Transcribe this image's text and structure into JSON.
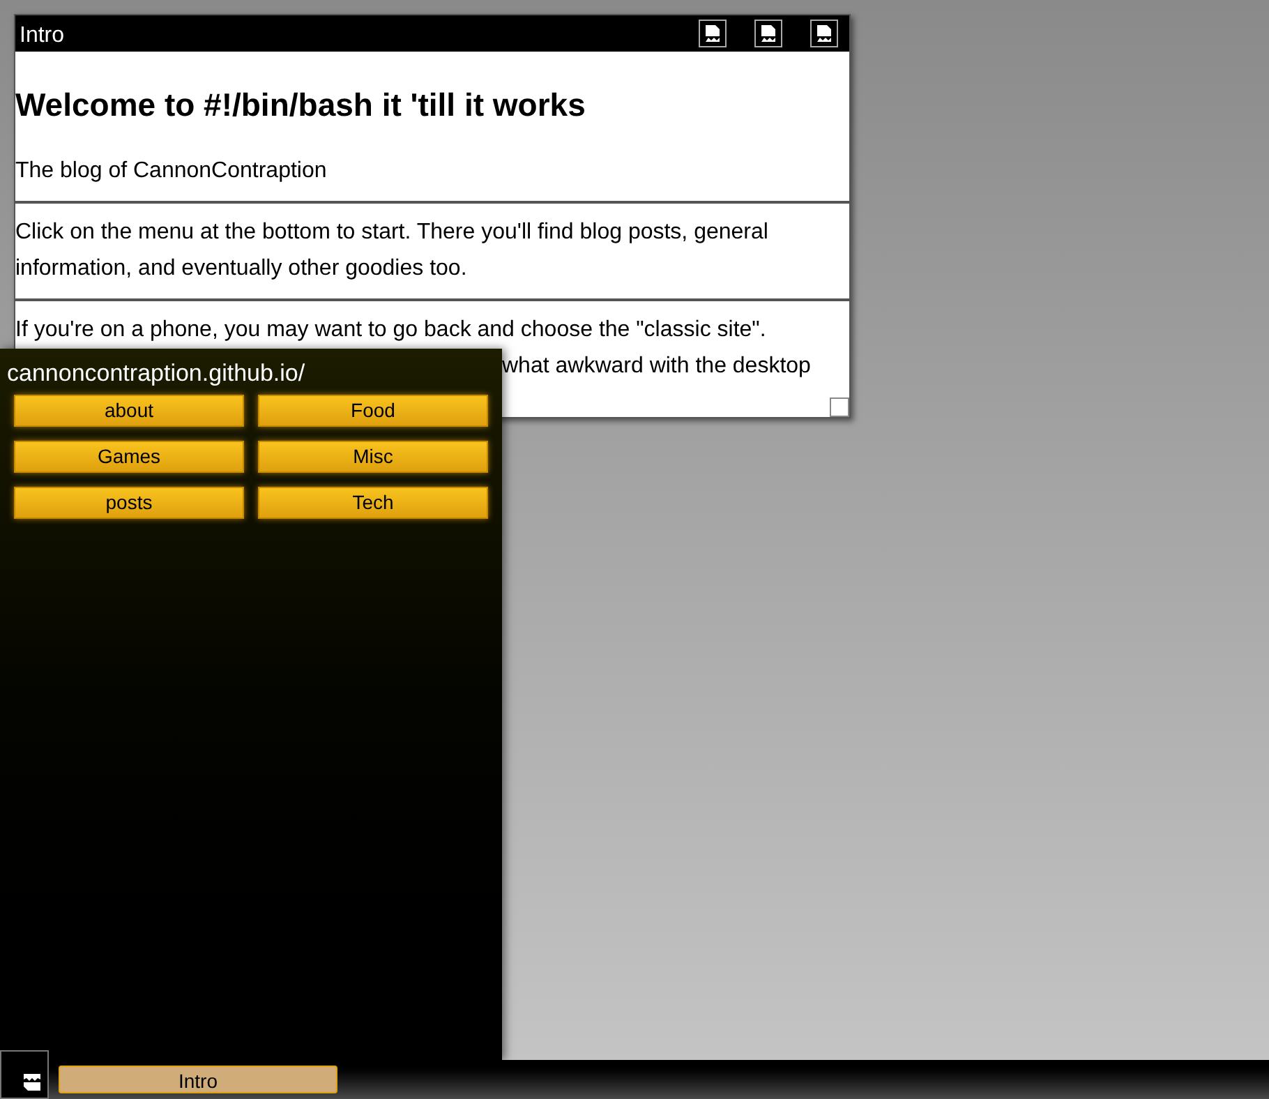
{
  "window": {
    "title": "Intro",
    "heading": "Welcome to #!/bin/bash it 'till it works",
    "paragraphs": [
      "The blog of CannonContraption",
      "Click on the menu at the bottom to start. There you'll find blog posts, general information, and eventually other goodies too.",
      "If you're on a phone, you may want to go back and choose the \"classic site\"."
    ],
    "partly_hidden_line": "what awkward with the desktop"
  },
  "menu": {
    "title": "cannoncontraption.github.io/",
    "items": [
      {
        "label": "about"
      },
      {
        "label": "Food"
      },
      {
        "label": "Games"
      },
      {
        "label": "Misc"
      },
      {
        "label": "posts"
      },
      {
        "label": "Tech"
      }
    ]
  },
  "taskbar": {
    "tasks": [
      {
        "label": "Intro",
        "selected": true
      }
    ]
  }
}
